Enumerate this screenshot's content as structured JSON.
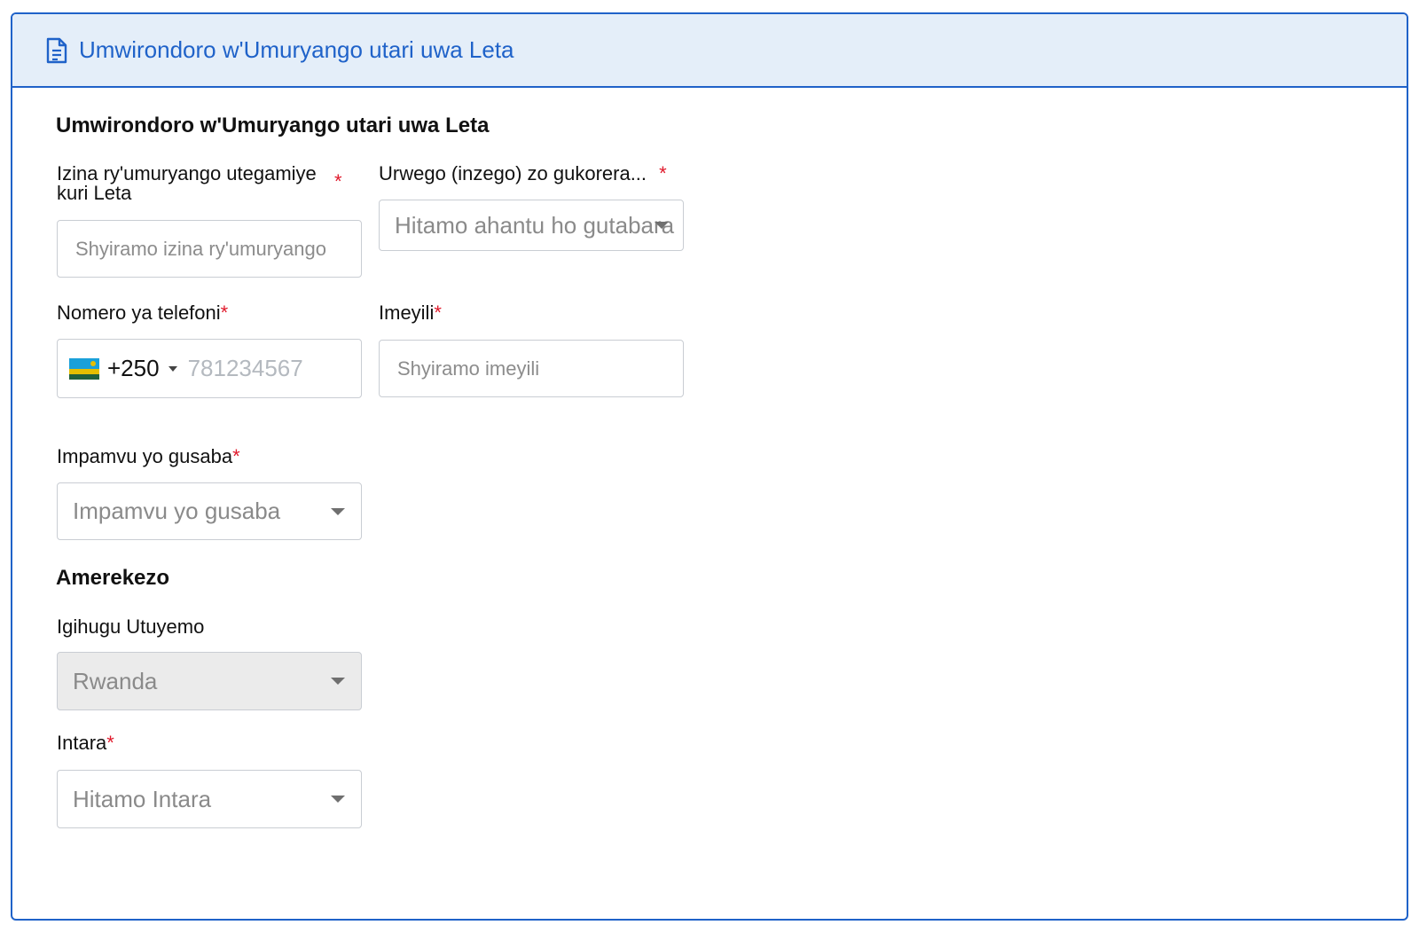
{
  "header": {
    "title": "Umwirondoro w'Umuryango utari uwa Leta",
    "icon": "document-icon"
  },
  "form": {
    "section_title": "Umwirondoro w'Umuryango utari uwa Leta",
    "org_name": {
      "label_line1": "Izina ry'umuryango utegamiye",
      "label_line2": "kuri Leta",
      "required": "*",
      "placeholder": "Shyiramo izina ry'umuryango"
    },
    "sector": {
      "label": "Urwego (inzego) zo gukorera...",
      "required": "*",
      "placeholder": "Hitamo ahantu ho gutabara"
    },
    "phone": {
      "label": "Nomero ya telefoni",
      "required": "*",
      "dial_code": "+250",
      "placeholder": "781234567",
      "flag": "rwanda-flag-icon"
    },
    "email": {
      "label": "Imeyili",
      "required": "*",
      "placeholder": "Shyiramo imeyili"
    },
    "reason": {
      "label": "Impamvu yo gusaba",
      "required": "*",
      "placeholder": "Impamvu yo gusaba"
    },
    "address_title": "Amerekezo",
    "country": {
      "label": "Igihugu Utuyemo",
      "value": "Rwanda",
      "disabled": true
    },
    "province": {
      "label": "Intara",
      "required": "*",
      "placeholder": "Hitamo Intara"
    }
  },
  "colors": {
    "accent": "#1f62c9",
    "header_bg": "#e4eef9",
    "required": "#e0192b"
  }
}
